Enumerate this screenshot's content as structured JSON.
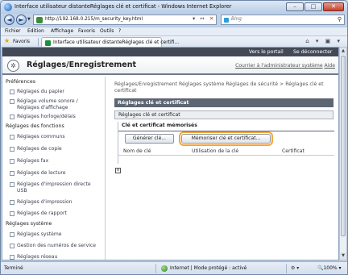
{
  "window": {
    "title": "Interface utilisateur distanteRéglages clé et certificat",
    "app": " - Windows Internet Explorer",
    "minimize": "–",
    "maximize": "□",
    "close": "✕"
  },
  "address": {
    "back": "◄",
    "forward": "►",
    "dropdown": "▼",
    "url": "http://192.168.0.215/m_security_key.html",
    "tools": "▾ ↔",
    "stop": "✕",
    "search_placeholder": "Bing",
    "search_glyph": "⚲"
  },
  "menu": [
    "Fichier",
    "Edition",
    "Affichage",
    "Favoris",
    "Outils",
    "?"
  ],
  "favorites": {
    "label": "Favoris",
    "tab_title": "Interface utilisateur distanteRéglages clé et certifi...",
    "tools": "⌂ ▾ ▣ ▾"
  },
  "page": {
    "top_links": [
      "Vers le portail",
      "Se déconnecter"
    ],
    "logo_glyph": "✲",
    "title": "Réglages/Enregistrement",
    "header_links": [
      "Courrier à l'administrateur système",
      "Aide"
    ],
    "sidebar": [
      {
        "kind": "section",
        "label": "Préférences"
      },
      {
        "kind": "item",
        "label": "Réglages du papier"
      },
      {
        "kind": "item",
        "label": "Réglage volume sonore /\nRéglages d'affichage"
      },
      {
        "kind": "item",
        "label": "Réglages horloge/délais"
      },
      {
        "kind": "section",
        "label": "Réglages des fonctions"
      },
      {
        "kind": "item",
        "label": "Réglages communs"
      },
      {
        "kind": "item",
        "label": "Réglages de copie"
      },
      {
        "kind": "item",
        "label": "Réglages fax"
      },
      {
        "kind": "item",
        "label": "Réglages de lecture"
      },
      {
        "kind": "item",
        "label": "Réglages d'impression directe\nUSB"
      },
      {
        "kind": "item",
        "label": "Réglages d'impression"
      },
      {
        "kind": "item",
        "label": "Réglages de rapport"
      },
      {
        "kind": "section",
        "label": "Réglages système"
      },
      {
        "kind": "item",
        "label": "Réglages système"
      },
      {
        "kind": "item",
        "label": "Gestion des numéros de service"
      },
      {
        "kind": "item",
        "label": "Réglages réseau"
      }
    ],
    "breadcrumb": "Réglages/Enregistrement Réglages système Réglages de sécurité > Réglages clé et certificat",
    "section_title": "Réglages clé et certificat",
    "subsection_title": "Réglages clé et certificat",
    "panel_title": "Clé et certificat mémorisés",
    "buttons": {
      "generate": "Générer clé...",
      "register": "Mémoriser clé et certificat..."
    },
    "columns": [
      "Nom de clé",
      "Utilisation de la clé",
      "Certificat"
    ],
    "small_icon": "≡"
  },
  "status": {
    "done": "Terminé",
    "zone": "Internet | Mode protégé : activé",
    "tools": "⚙ ▾",
    "zoom": "🔍100% ▾"
  }
}
